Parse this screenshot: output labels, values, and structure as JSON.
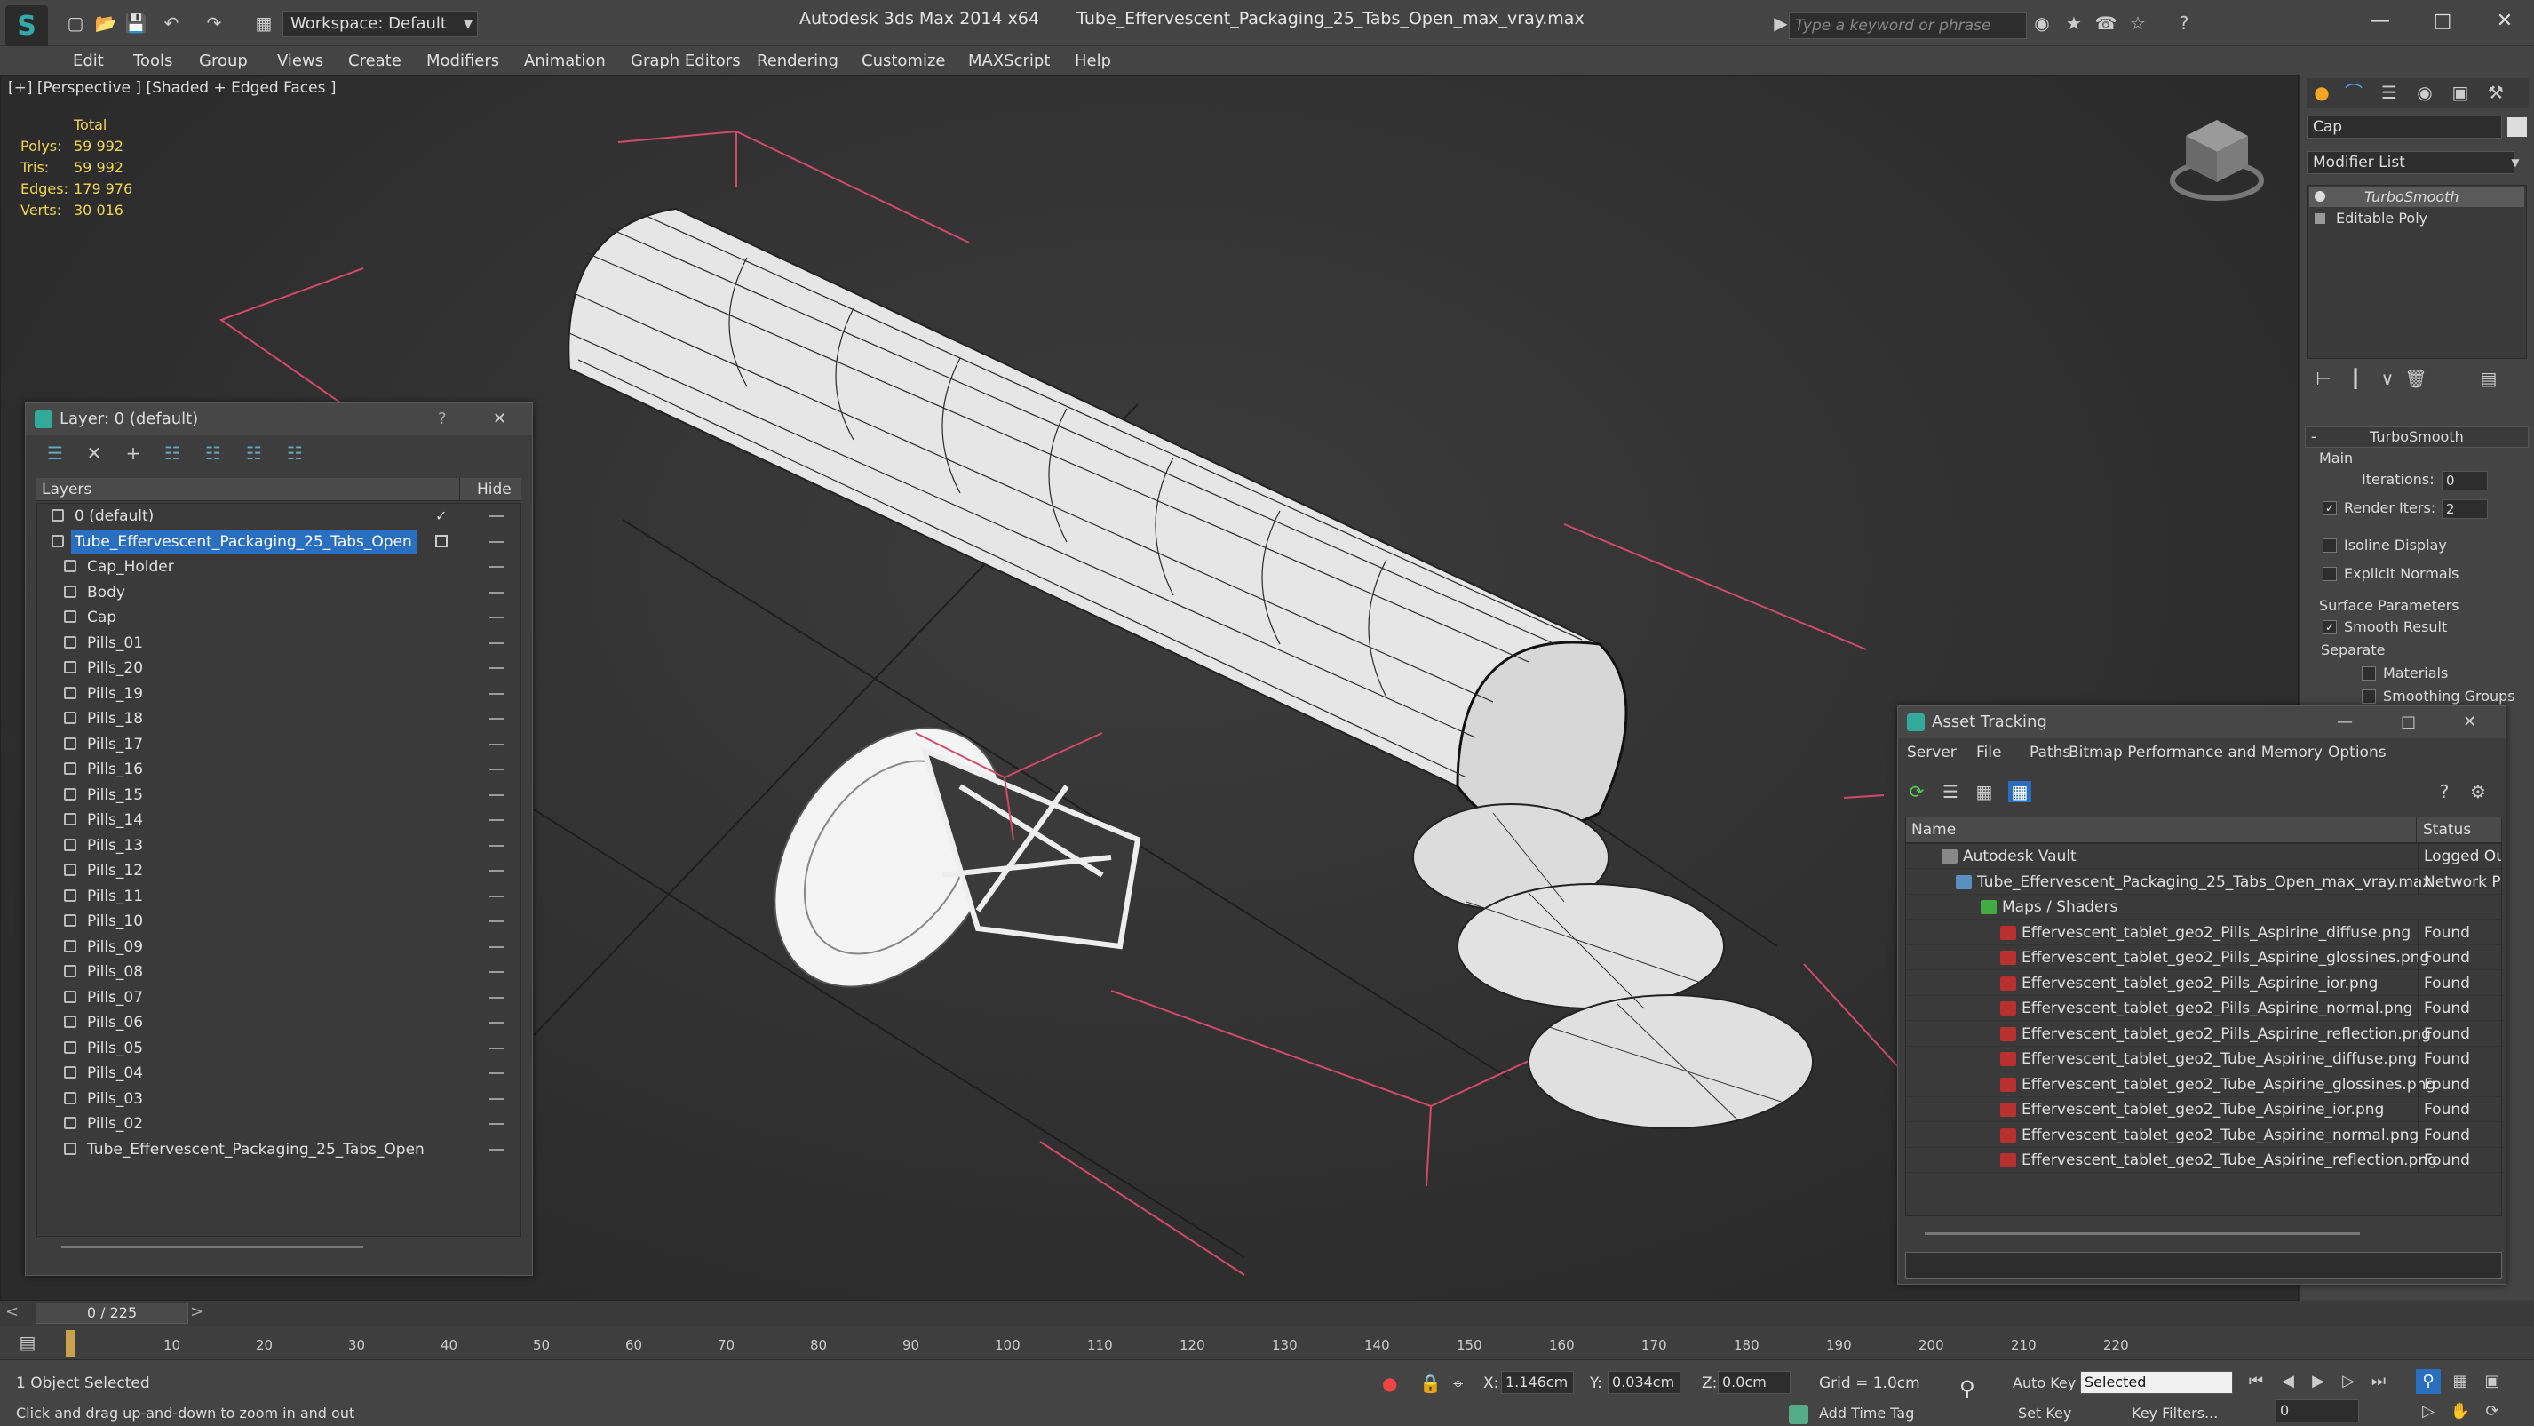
{
  "titlebar": {
    "workspace": "Workspace: Default",
    "app_name": "Autodesk 3ds Max  2014 x64",
    "file_name": "Tube_Effervescent_Packaging_25_Tabs_Open_max_vray.max",
    "search_placeholder": "Type a keyword or phrase"
  },
  "menu": [
    "Edit",
    "Tools",
    "Group",
    "Views",
    "Create",
    "Modifiers",
    "Animation",
    "Graph Editors",
    "Rendering",
    "Customize",
    "MAXScript",
    "Help"
  ],
  "viewport": {
    "label": "[+] [Perspective ] [Shaded + Edged Faces ]",
    "stats": {
      "header": "Total",
      "rows": [
        {
          "label": "Polys:",
          "value": "59 992"
        },
        {
          "label": "Tris:",
          "value": "59 992"
        },
        {
          "label": "Edges:",
          "value": "179 976"
        },
        {
          "label": "Verts:",
          "value": "30 016"
        }
      ]
    }
  },
  "command_panel": {
    "object_name": "Cap",
    "modifier_list": "Modifier List",
    "stack": [
      "TurboSmooth",
      "Editable Poly"
    ],
    "rollout_title": "TurboSmooth",
    "main_label": "Main",
    "iterations_label": "Iterations:",
    "iterations_value": "0",
    "render_iters_label": "Render Iters:",
    "render_iters_value": "2",
    "isoline_label": "Isoline Display",
    "explicit_normals_label": "Explicit Normals",
    "surface_params_label": "Surface Parameters",
    "smooth_result_label": "Smooth Result",
    "separate_label": "Separate",
    "materials_label": "Materials",
    "smoothing_groups_label": "Smoothing Groups"
  },
  "layer_explorer": {
    "title": "Layer: 0 (default)",
    "col_layers": "Layers",
    "col_hide": "Hide",
    "rows": [
      {
        "name": "0 (default)",
        "level": 0,
        "type": "layer"
      },
      {
        "name": "Tube_Effervescent_Packaging_25_Tabs_Open",
        "level": 0,
        "type": "layer",
        "selected": true
      },
      {
        "name": "Cap_Holder",
        "level": 1,
        "type": "object"
      },
      {
        "name": "Body",
        "level": 1,
        "type": "object"
      },
      {
        "name": "Cap",
        "level": 1,
        "type": "object"
      },
      {
        "name": "Pills_01",
        "level": 1,
        "type": "object"
      },
      {
        "name": "Pills_20",
        "level": 1,
        "type": "object"
      },
      {
        "name": "Pills_19",
        "level": 1,
        "type": "object"
      },
      {
        "name": "Pills_18",
        "level": 1,
        "type": "object"
      },
      {
        "name": "Pills_17",
        "level": 1,
        "type": "object"
      },
      {
        "name": "Pills_16",
        "level": 1,
        "type": "object"
      },
      {
        "name": "Pills_15",
        "level": 1,
        "type": "object"
      },
      {
        "name": "Pills_14",
        "level": 1,
        "type": "object"
      },
      {
        "name": "Pills_13",
        "level": 1,
        "type": "object"
      },
      {
        "name": "Pills_12",
        "level": 1,
        "type": "object"
      },
      {
        "name": "Pills_11",
        "level": 1,
        "type": "object"
      },
      {
        "name": "Pills_10",
        "level": 1,
        "type": "object"
      },
      {
        "name": "Pills_09",
        "level": 1,
        "type": "object"
      },
      {
        "name": "Pills_08",
        "level": 1,
        "type": "object"
      },
      {
        "name": "Pills_07",
        "level": 1,
        "type": "object"
      },
      {
        "name": "Pills_06",
        "level": 1,
        "type": "object"
      },
      {
        "name": "Pills_05",
        "level": 1,
        "type": "object"
      },
      {
        "name": "Pills_04",
        "level": 1,
        "type": "object"
      },
      {
        "name": "Pills_03",
        "level": 1,
        "type": "object"
      },
      {
        "name": "Pills_02",
        "level": 1,
        "type": "object"
      },
      {
        "name": "Tube_Effervescent_Packaging_25_Tabs_Open",
        "level": 1,
        "type": "object"
      }
    ]
  },
  "asset_tracking": {
    "title": "Asset Tracking",
    "menu": [
      "Server",
      "File",
      "Paths",
      "Bitmap Performance and Memory",
      "Options"
    ],
    "col_name": "Name",
    "col_status": "Status",
    "rows": [
      {
        "name": "Autodesk Vault",
        "status": "Logged Out",
        "level": 0,
        "kind": "vault"
      },
      {
        "name": "Tube_Effervescent_Packaging_25_Tabs_Open_max_vray.max",
        "status": "Network Pa",
        "level": 1,
        "kind": "max"
      },
      {
        "name": "Maps / Shaders",
        "status": "",
        "level": 2,
        "kind": "folder"
      },
      {
        "name": "Effervescent_tablet_geo2_Pills_Aspirine_diffuse.png",
        "status": "Found",
        "level": 3,
        "kind": "file"
      },
      {
        "name": "Effervescent_tablet_geo2_Pills_Aspirine_glossines.png",
        "status": "Found",
        "level": 3,
        "kind": "file"
      },
      {
        "name": "Effervescent_tablet_geo2_Pills_Aspirine_ior.png",
        "status": "Found",
        "level": 3,
        "kind": "file"
      },
      {
        "name": "Effervescent_tablet_geo2_Pills_Aspirine_normal.png",
        "status": "Found",
        "level": 3,
        "kind": "file"
      },
      {
        "name": "Effervescent_tablet_geo2_Pills_Aspirine_reflection.png",
        "status": "Found",
        "level": 3,
        "kind": "file"
      },
      {
        "name": "Effervescent_tablet_geo2_Tube_Aspirine_diffuse.png",
        "status": "Found",
        "level": 3,
        "kind": "file"
      },
      {
        "name": "Effervescent_tablet_geo2_Tube_Aspirine_glossines.png",
        "status": "Found",
        "level": 3,
        "kind": "file"
      },
      {
        "name": "Effervescent_tablet_geo2_Tube_Aspirine_ior.png",
        "status": "Found",
        "level": 3,
        "kind": "file"
      },
      {
        "name": "Effervescent_tablet_geo2_Tube_Aspirine_normal.png",
        "status": "Found",
        "level": 3,
        "kind": "file"
      },
      {
        "name": "Effervescent_tablet_geo2_Tube_Aspirine_reflection.png",
        "status": "Found",
        "level": 3,
        "kind": "file"
      }
    ]
  },
  "timeline": {
    "frame_counter": "0 / 225",
    "ticks": [
      "0",
      "10",
      "20",
      "30",
      "40",
      "50",
      "60",
      "70",
      "80",
      "90",
      "100",
      "110",
      "120",
      "130",
      "140",
      "150",
      "160",
      "170",
      "180",
      "190",
      "200",
      "210",
      "220"
    ]
  },
  "status": {
    "selection": "1 Object Selected",
    "prompt": "Click and drag up-and-down to zoom in and out",
    "x_label": "X:",
    "x_value": "1.146cm",
    "y_label": "Y:",
    "y_value": "0.034cm",
    "z_label": "Z:",
    "z_value": "0.0cm",
    "grid": "Grid = 1.0cm",
    "add_time_tag": "Add Time Tag",
    "auto_key": "Auto Key",
    "set_key": "Set Key",
    "selected_dropdown": "Selected",
    "key_filters": "Key Filters...",
    "current_frame": "0"
  },
  "colors": {
    "selection": "#2a6fbf",
    "stats": "#f2d54a",
    "wireframe": "#ffffff",
    "grid_lines": "#d04a6a"
  }
}
